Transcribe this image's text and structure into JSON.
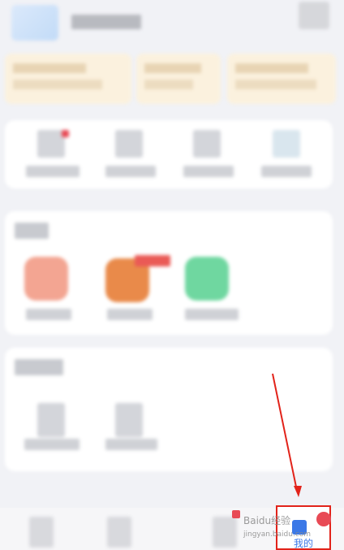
{
  "tab_bar": {
    "mine_label": "我的"
  },
  "watermark": {
    "text": "Baidu经验",
    "subtext": "jingyan.baidu.com"
  },
  "colors": {
    "accent": "#3b78e7",
    "highlight_box": "#e2231a",
    "annotation_arrow": "#e2231a",
    "badge": "#e84a55"
  }
}
